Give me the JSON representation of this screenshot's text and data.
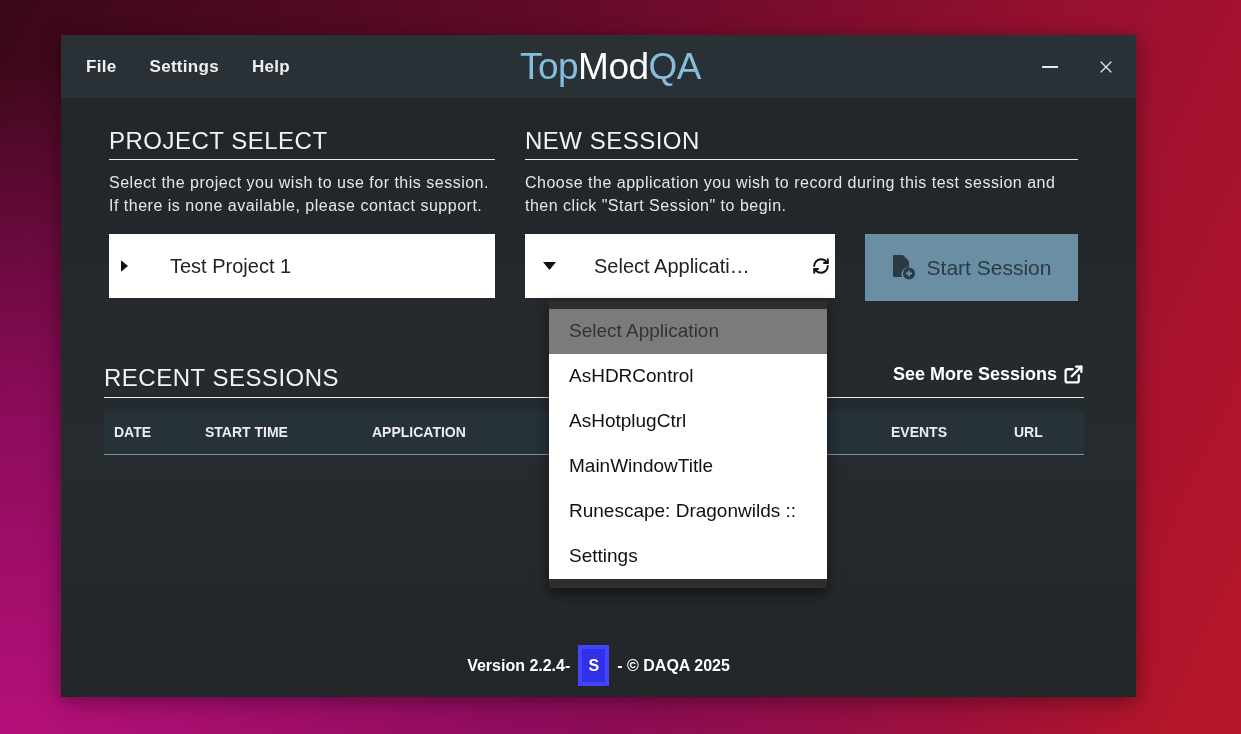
{
  "menu": [
    "File",
    "Settings",
    "Help"
  ],
  "logo": [
    {
      "text": "Top",
      "accent": true
    },
    {
      "text": "Mod",
      "accent": false
    },
    {
      "text": "QA",
      "accent": true
    }
  ],
  "project_select": {
    "title": "PROJECT SELECT",
    "description": "Select the project you wish to use for this session. If there is none available, please contact support.",
    "select": {
      "value": "Test Project 1",
      "expanded": false
    }
  },
  "new_session": {
    "title": "NEW SESSION",
    "description": "Choose the application you wish to record during this test session and then click \"Start Session\" to begin.",
    "select": {
      "value": "Select Applicati…",
      "expanded": true,
      "options": [
        {
          "label": "Select Application",
          "selected": true
        },
        {
          "label": "AsHDRControl",
          "selected": false
        },
        {
          "label": "AsHotplugCtrl",
          "selected": false
        },
        {
          "label": "MainWindowTitle",
          "selected": false
        },
        {
          "label": "Runescape: Dragonwilds ::",
          "selected": false
        },
        {
          "label": "Settings",
          "selected": false
        }
      ]
    },
    "start_button": {
      "label": "Start Session",
      "disabled": true
    }
  },
  "recent_sessions": {
    "title": "RECENT SESSIONS",
    "link": "See More Sessions",
    "columns": [
      "DATE",
      "START TIME",
      "APPLICATION",
      "EVENTS",
      "URL"
    ]
  },
  "footer": {
    "version": "Version 2.2.4-",
    "badge": "S",
    "copyright": "- © DAQA 2025"
  }
}
